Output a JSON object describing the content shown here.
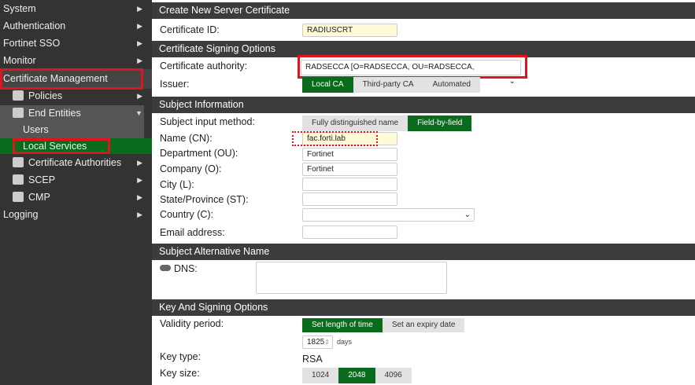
{
  "sidebar": {
    "items": [
      {
        "label": "System"
      },
      {
        "label": "Authentication"
      },
      {
        "label": "Fortinet SSO"
      },
      {
        "label": "Monitor"
      },
      {
        "label": "Certificate Management"
      },
      {
        "label": "Policies"
      },
      {
        "label": "End Entities"
      },
      {
        "label": "Users"
      },
      {
        "label": "Local Services"
      },
      {
        "label": "Certificate Authorities"
      },
      {
        "label": "SCEP"
      },
      {
        "label": "CMP"
      },
      {
        "label": "Logging"
      }
    ]
  },
  "main": {
    "title": "Create New Server Certificate",
    "cert_id_label": "Certificate ID:",
    "cert_id_value": "RADIUSCRT",
    "signing_section": "Certificate Signing Options",
    "ca_label": "Certificate authority:",
    "ca_value": "RADSECCA [O=RADSECCA, OU=RADSECCA, CN=RADSECCA]",
    "issuer_label": "Issuer:",
    "issuer_options": [
      "Local CA",
      "Third-party CA",
      "Automated"
    ],
    "issuer_selected": "Local CA",
    "subject_section": "Subject Information",
    "input_method_label": "Subject input method:",
    "input_method_options": [
      "Fully distinguished name",
      "Field-by-field"
    ],
    "input_method_selected": "Field-by-field",
    "cn_label": "Name (CN):",
    "cn_value": "fac.forti.lab",
    "ou_label": "Department (OU):",
    "ou_value": "Fortinet",
    "o_label": "Company (O):",
    "o_value": "Fortinet",
    "city_label": "City (L):",
    "state_label": "State/Province (ST):",
    "country_label": "Country (C):",
    "email_label": "Email address:",
    "san_section": "Subject Alternative Name",
    "dns_label": "DNS:",
    "key_section": "Key And Signing Options",
    "validity_label": "Validity period:",
    "validity_options": [
      "Set length of time",
      "Set an expiry date"
    ],
    "validity_selected": "Set length of time",
    "days_value": "1825",
    "days_unit": "days",
    "key_type_label": "Key type:",
    "key_type_value": "RSA",
    "key_size_label": "Key size:",
    "key_size_options": [
      "1024",
      "2048",
      "4096"
    ],
    "key_size_selected": "2048"
  },
  "colors": {
    "accent": "#0b6b1c",
    "highlight": "#e0141e",
    "sidebar": "#333333"
  }
}
